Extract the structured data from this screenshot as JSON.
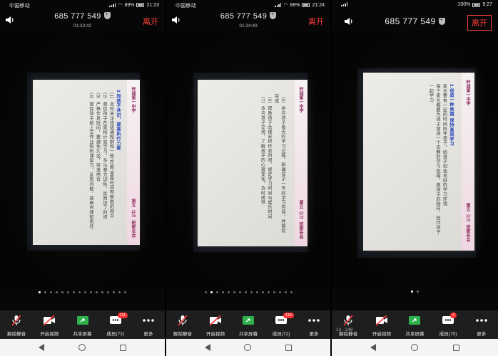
{
  "panels": [
    {
      "status": {
        "carrier": "中国移动",
        "battery": "89%",
        "time": "21:23"
      },
      "header": {
        "meeting_id": "685 777 549",
        "timer": "01:33:42",
        "leave": "离开"
      },
      "slide": {
        "band": "轩城第一中学",
        "tag": "第五（17）班家长会",
        "lines": [
          "2.同孩子共识、提高执行力度",
          "（1）及时关注班级通知群和一些“在家”里是时间有帮助的观点",
          "（2）督促孩子在家按计划学习，多注意力训练，反而加了时间",
          "（3）严格作息时间，要避免久坐，劳逸结合",
          "（4）督促孩子按上交作业和听课复习，反思问题，提高自律和责任"
        ]
      },
      "dots_count": 16,
      "active_dot": 0,
      "toolbar": [
        {
          "label": "解除静音",
          "icon": "mic-muted-icon"
        },
        {
          "label": "开启视频",
          "icon": "video-off-icon"
        },
        {
          "label": "共享屏幕",
          "icon": "share-screen-icon"
        },
        {
          "label": "成员(72)",
          "icon": "participants-icon",
          "badge": "111"
        },
        {
          "label": "更多",
          "icon": "more-icon"
        }
      ]
    },
    {
      "status": {
        "carrier": "中国移动",
        "battery": "88%",
        "time": "21:24"
      },
      "header": {
        "meeting_id": "685 777 549",
        "timer": "01:34:49",
        "leave": "离开"
      },
      "slide": {
        "band": "轩城第一中学",
        "tag": "第五（17）班家长会",
        "lines": [
          "（5）参与孩子每天的学习过程，明确孩子一天的学习内容，并督促完成",
          "（6）帮助孩子合理安排作息时间，规定学习时间与娱乐时间",
          "（7）多与孩子交流，了解孩子的心理变化，及时疏导"
        ]
      },
      "dots_count": 16,
      "active_dot": 1,
      "toolbar": [
        {
          "label": "解除静音",
          "icon": "mic-muted-icon"
        },
        {
          "label": "开启视频",
          "icon": "video-off-icon"
        },
        {
          "label": "共享屏幕",
          "icon": "share-screen-icon"
        },
        {
          "label": "成员(72)",
          "icon": "participants-icon",
          "badge": "119"
        },
        {
          "label": "更多",
          "icon": "more-icon"
        }
      ]
    },
    {
      "status": {
        "carrier": "",
        "battery": "100%",
        "time": "9:27"
      },
      "header": {
        "meeting_id": "685 777 549",
        "timer": "",
        "leave": "离开"
      },
      "slide": {
        "band": "轩城第一中学",
        "tag": "第五（17）班家长会",
        "lines": [
          "3.创造一种氛围 保持高效学习",
          "家长要有一定的时间陪伴孩子，给孩子创造良好的学习环境",
          "每个家长都要为孩子营造一个安静的学习氛围，做孩子的榜样，陪伴孩子一起学习"
        ]
      },
      "dots_count": 2,
      "active_dot": 0,
      "toolbar_hint": "13...248",
      "toolbar": [
        {
          "label": "解除静音",
          "icon": "mic-muted-icon"
        },
        {
          "label": "开启视频",
          "icon": "video-off-icon"
        },
        {
          "label": "共享屏幕",
          "icon": "share-screen-icon"
        },
        {
          "label": "成员(70)",
          "icon": "participants-icon",
          "badge": "2"
        },
        {
          "label": "更多",
          "icon": "more-icon"
        }
      ]
    }
  ]
}
